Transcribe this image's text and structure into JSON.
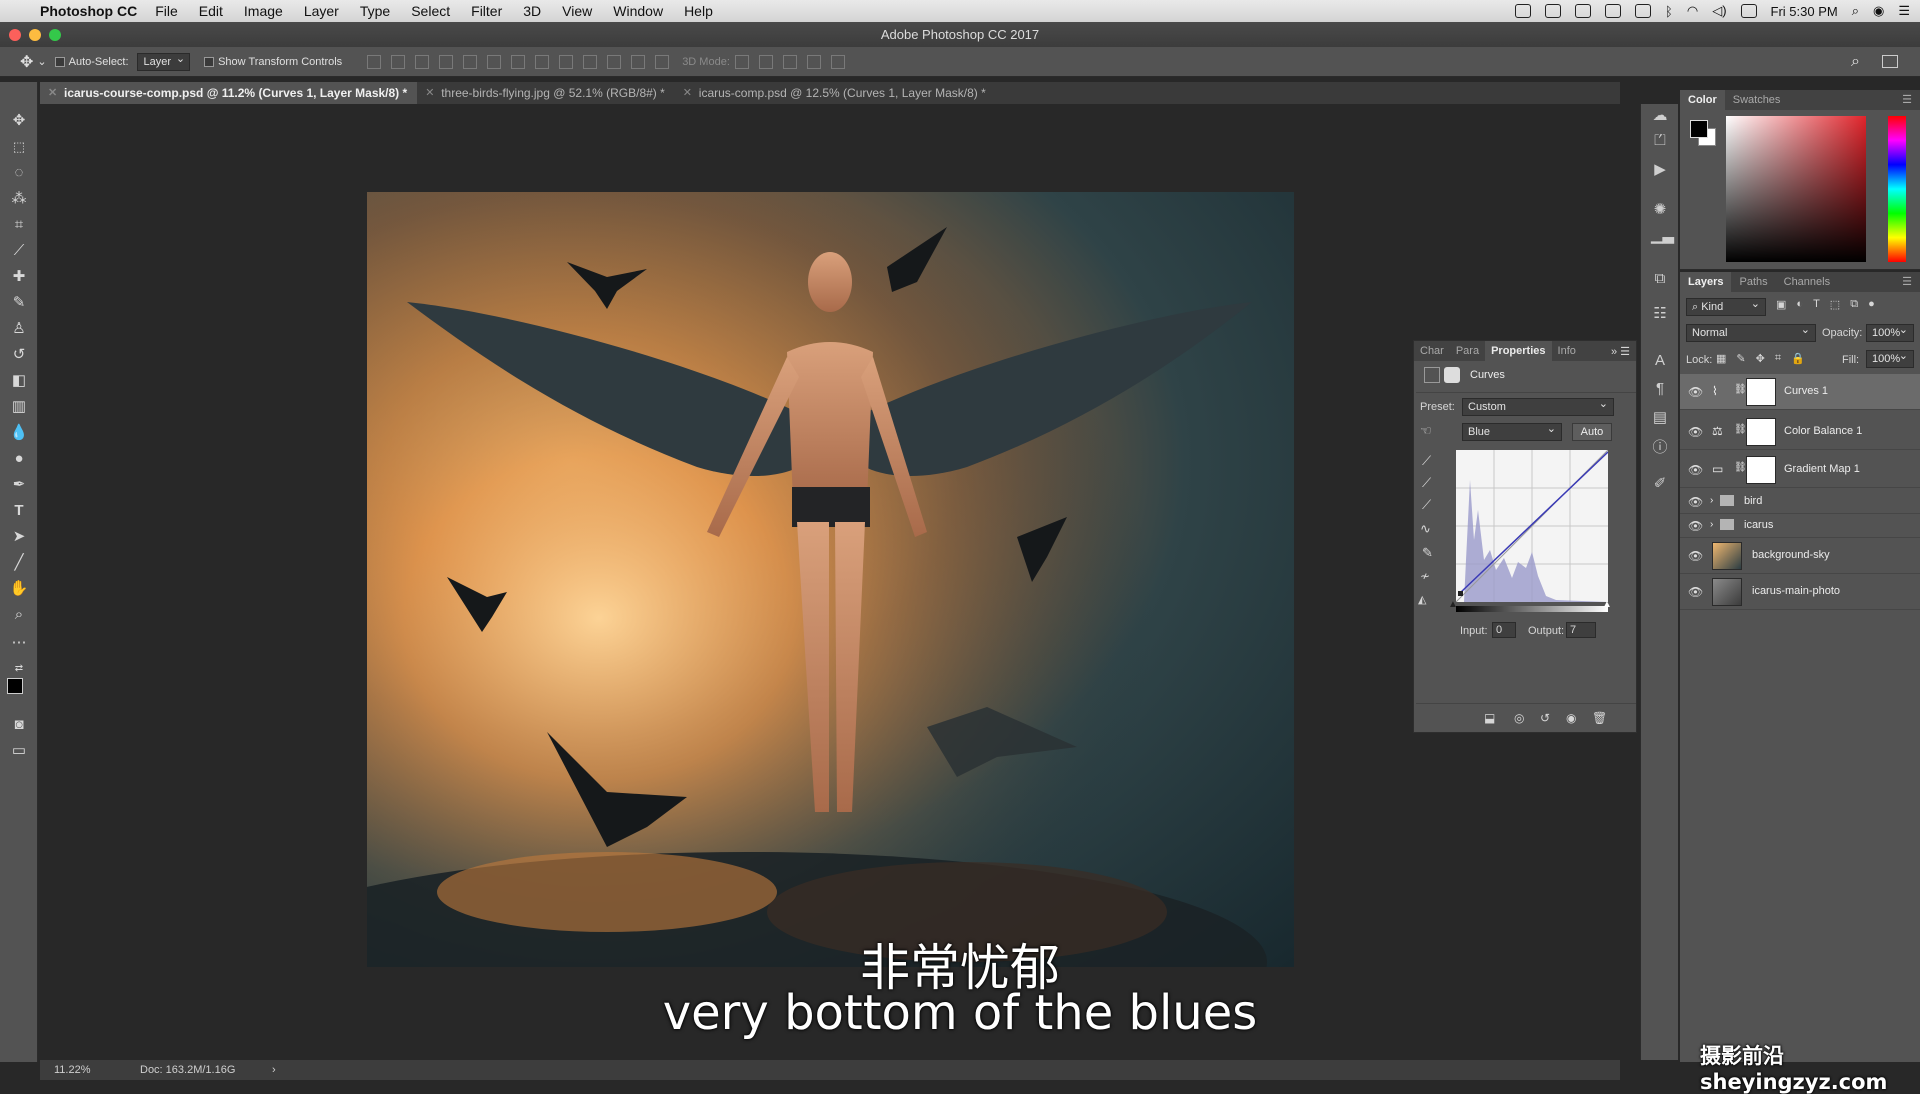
{
  "menubar": {
    "app_name": "Photoshop CC",
    "items": [
      "File",
      "Edit",
      "Image",
      "Layer",
      "Type",
      "Select",
      "Filter",
      "3D",
      "View",
      "Window",
      "Help"
    ],
    "clock": "Fri 5:30 PM"
  },
  "window": {
    "title": "Adobe Photoshop CC 2017"
  },
  "options_bar": {
    "auto_select_label": "Auto-Select:",
    "auto_select_value": "Layer",
    "transform_label": "Show Transform Controls",
    "mode_3d_label": "3D Mode:"
  },
  "tabs": [
    {
      "label": "icarus-course-comp.psd @ 11.2% (Curves 1, Layer Mask/8) *",
      "active": true
    },
    {
      "label": "three-birds-flying.jpg @ 52.1% (RGB/8#) *",
      "active": false
    },
    {
      "label": "icarus-comp.psd @ 12.5% (Curves 1, Layer Mask/8) *",
      "active": false
    }
  ],
  "status_bar": {
    "zoom": "11.22%",
    "doc": "Doc: 163.2M/1.16G"
  },
  "subtitles": {
    "chinese": "非常忧郁",
    "english": "very bottom of the blues"
  },
  "properties_panel": {
    "tabs": [
      "Char",
      "Para",
      "Properties",
      "Info"
    ],
    "active_tab": "Properties",
    "header_label": "Curves",
    "preset_label": "Preset:",
    "preset_value": "Custom",
    "channel_value": "Blue",
    "auto_label": "Auto",
    "input_label": "Input:",
    "input_value": "0",
    "output_label": "Output:",
    "output_value": "7"
  },
  "color_panel": {
    "tabs": [
      "Color",
      "Swatches"
    ]
  },
  "layers_panel": {
    "tabs": [
      "Layers",
      "Paths",
      "Channels"
    ],
    "filter_label": "Kind",
    "blend_mode": "Normal",
    "opacity_label": "Opacity:",
    "opacity_value": "100%",
    "lock_label": "Lock:",
    "fill_label": "Fill:",
    "fill_value": "100%",
    "layers": [
      {
        "name": "Curves 1",
        "type": "adjustment",
        "icon": "curves-icon",
        "selected": true
      },
      {
        "name": "Color Balance 1",
        "type": "adjustment",
        "icon": "balance-icon",
        "selected": false
      },
      {
        "name": "Gradient Map 1",
        "type": "adjustment",
        "icon": "gradient-map-icon",
        "selected": false
      },
      {
        "name": "bird",
        "type": "group",
        "icon": "folder-icon",
        "selected": false
      },
      {
        "name": "icarus",
        "type": "group",
        "icon": "folder-icon",
        "selected": false
      },
      {
        "name": "background-sky",
        "type": "pixel",
        "icon": "image-icon",
        "selected": false
      },
      {
        "name": "icarus-main-photo",
        "type": "pixel",
        "icon": "image-icon",
        "selected": false
      }
    ]
  },
  "watermark": "摄影前沿 sheyingzyz.com",
  "colors": {
    "panel_bg": "#535353",
    "canvas_bg": "#282828",
    "selected_row": "#6b6b6b"
  }
}
